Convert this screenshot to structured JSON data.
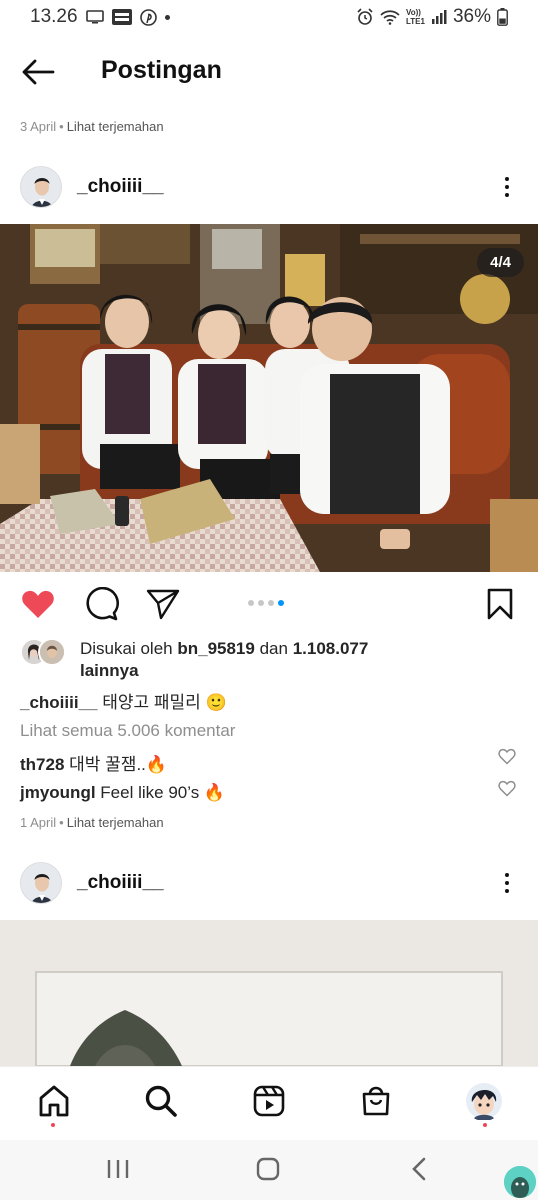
{
  "status_bar": {
    "time": "13.26",
    "battery": "36%",
    "network": "LTE1",
    "volte": "Vo))"
  },
  "header": {
    "title": "Postingan"
  },
  "previous_post": {
    "date": "3 April",
    "translate": "Lihat terjemahan"
  },
  "post": {
    "username": "_choiiii__",
    "image_counter": "4/4",
    "carousel": {
      "total": 4,
      "active": 4
    },
    "liked": true,
    "likes_prefix": "Disukai oleh",
    "liked_by_user": "bn_95819",
    "likes_and": "dan",
    "likes_count": "1.108.077",
    "likes_suffix": "lainnya",
    "caption_user": "_choiiii__",
    "caption_text": "태양고 패밀리 🙂",
    "view_comments": "Lihat semua 5.006 komentar",
    "comments": [
      {
        "user": "th728",
        "text": "대박 꿀잼..🔥"
      },
      {
        "user": "jmyoungl",
        "text": "Feel like 90’s 🔥"
      }
    ],
    "date": "1 April",
    "translate": "Lihat terjemahan"
  },
  "next_post": {
    "username": "_choiiii__"
  },
  "bottom_nav": {
    "items": [
      "home-icon",
      "search-icon",
      "reels-icon",
      "shop-icon",
      "profile-avatar"
    ]
  },
  "colors": {
    "like_red": "#ed4956",
    "active_dot": "#0095f6",
    "text_primary": "#262626",
    "text_secondary": "#8e8e8e"
  }
}
